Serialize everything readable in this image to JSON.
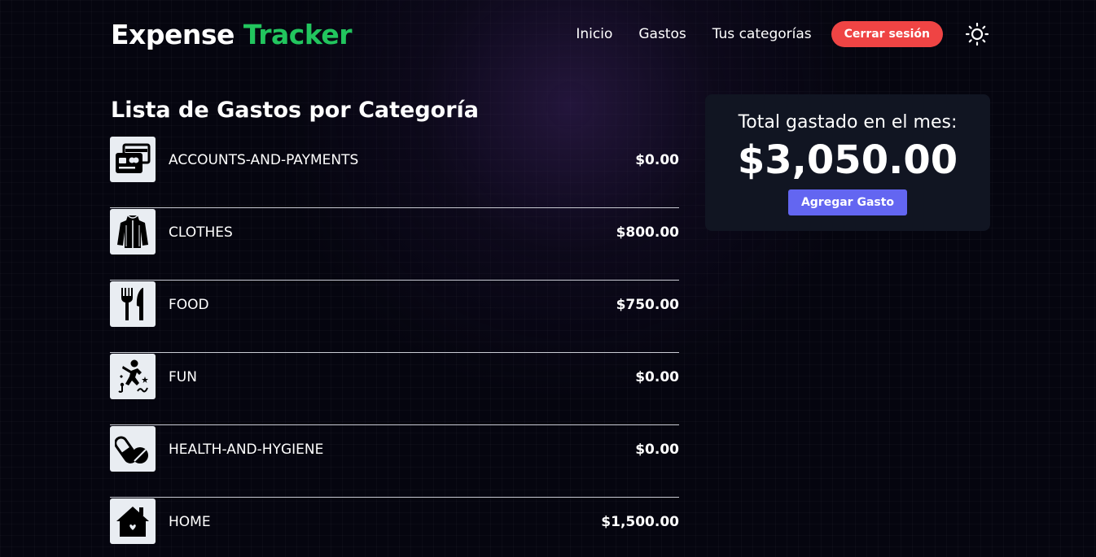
{
  "brand": {
    "part1": "Expense",
    "part2": "Tracker",
    "accent_color": "#22c55e"
  },
  "nav": {
    "items": [
      "Inicio",
      "Gastos",
      "Tus categorías"
    ],
    "logout_label": "Cerrar sesión",
    "logout_color": "#ef4444",
    "theme_icon": "sun-icon"
  },
  "main": {
    "title": "Lista de Gastos por Categoría"
  },
  "categories": [
    {
      "name": "ACCOUNTS-AND-PAYMENTS",
      "amount": "$0.00",
      "icon": "credit-cards-icon"
    },
    {
      "name": "CLOTHES",
      "amount": "$800.00",
      "icon": "jacket-icon"
    },
    {
      "name": "FOOD",
      "amount": "$750.00",
      "icon": "fork-knife-icon"
    },
    {
      "name": "FUN",
      "amount": "$0.00",
      "icon": "dancing-person-icon"
    },
    {
      "name": "HEALTH-AND-HYGIENE",
      "amount": "$0.00",
      "icon": "pills-icon"
    },
    {
      "name": "HOME",
      "amount": "$1,500.00",
      "icon": "house-icon"
    }
  ],
  "summary": {
    "label": "Total gastado en el mes:",
    "total": "$3,050.00",
    "add_label": "Agregar Gasto",
    "add_color": "#6366f1"
  }
}
